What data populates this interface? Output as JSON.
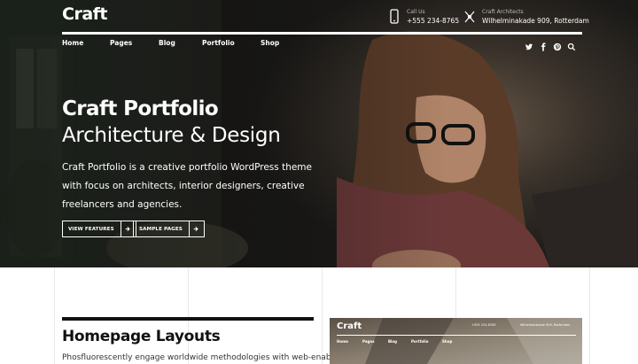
{
  "site": {
    "logo": "Craft"
  },
  "header": {
    "phone_label": "Call Us",
    "phone": "+555 234-8765",
    "address_label": "Craft Architects",
    "address": "Wilhelminakade 909, Rotterdam"
  },
  "nav": {
    "items": [
      "Home",
      "Pages",
      "Blog",
      "Portfolio",
      "Shop"
    ]
  },
  "social": {
    "icons": [
      "twitter-icon",
      "facebook-icon",
      "pinterest-icon",
      "search-icon"
    ]
  },
  "hero": {
    "title": "Craft Portfolio",
    "subtitle": "Architecture & Design",
    "description": "Craft Portfolio is a creative portfolio WordPress theme with focus on architects, interior designers, creative freelancers and agencies.",
    "buttons": [
      "VIEW FEATURES",
      "SAMPLE PAGES"
    ]
  },
  "section": {
    "title": "Homepage Layouts",
    "text": "Phosfluorescently engage worldwide methodologies with web-enabled"
  },
  "thumbnail": {
    "logo": "Craft",
    "nav": [
      "Home",
      "Pages",
      "Blog",
      "Portfolio",
      "Shop"
    ],
    "phone": "+555 234-8765",
    "address": "Wilhelminakade 909, Rotterdam"
  },
  "colors": {
    "text_dark": "#111111",
    "white": "#ffffff",
    "hero_dark": "#1b1b19"
  }
}
